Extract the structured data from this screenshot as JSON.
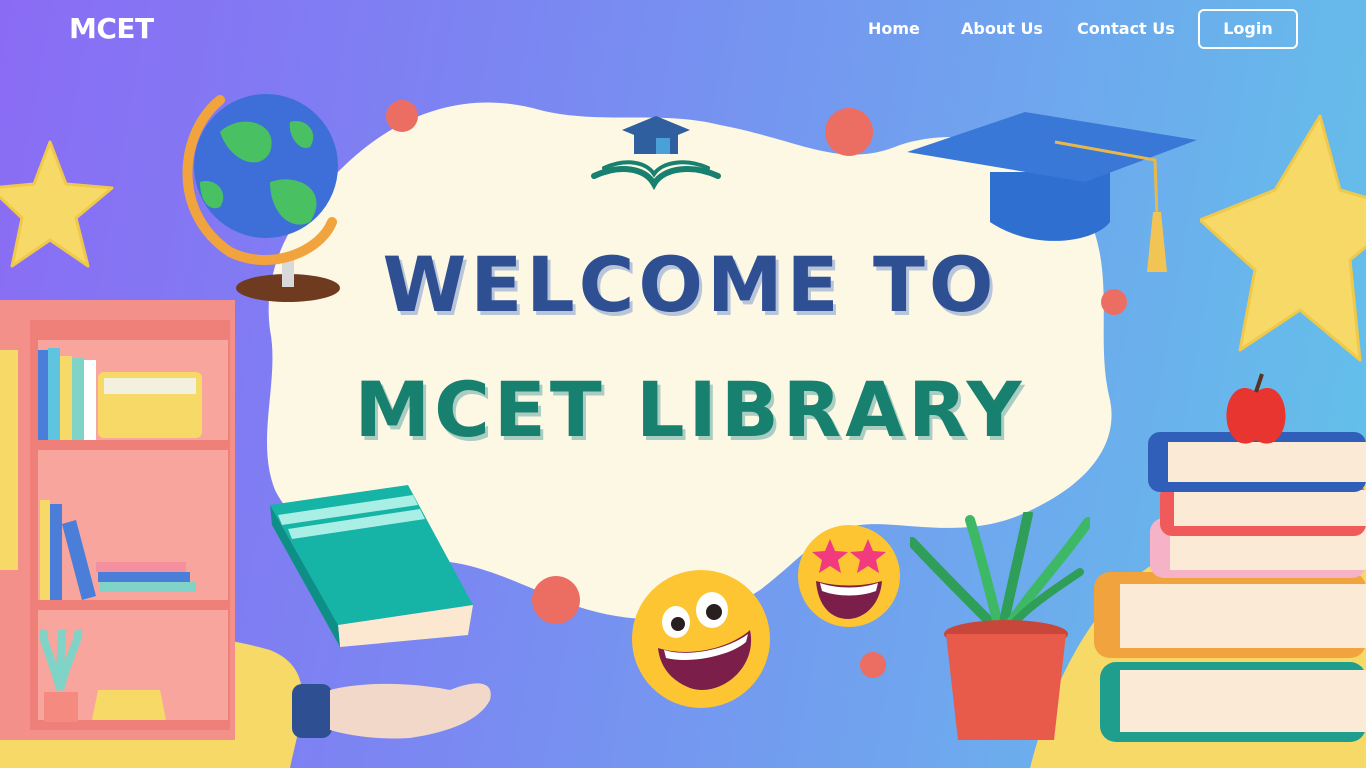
{
  "nav": {
    "brand": "MCET",
    "links": [
      {
        "label": "Home"
      },
      {
        "label": "About Us"
      },
      {
        "label": "Contact Us"
      }
    ],
    "login_label": "Login"
  },
  "hero": {
    "title_line_1": "WELCOME TO",
    "title_line_2": "MCET LIBRARY"
  },
  "colors": {
    "bg_start": "#8a6cf4",
    "bg_end": "#62c3e9",
    "blob": "#fdf8e4",
    "title_blue": "#2f4f93",
    "title_teal": "#17806f",
    "accent_yellow": "#f6d966",
    "accent_coral": "#ec6e62"
  },
  "icons": [
    "library-logo-icon",
    "globe-icon",
    "star-icon",
    "bookshelf-icon",
    "graduation-cap-icon",
    "book-icon",
    "hand-icon",
    "grinning-emoji-icon",
    "star-eyes-emoji-icon",
    "potted-plant-icon",
    "book-stack-icon",
    "apple-icon"
  ]
}
